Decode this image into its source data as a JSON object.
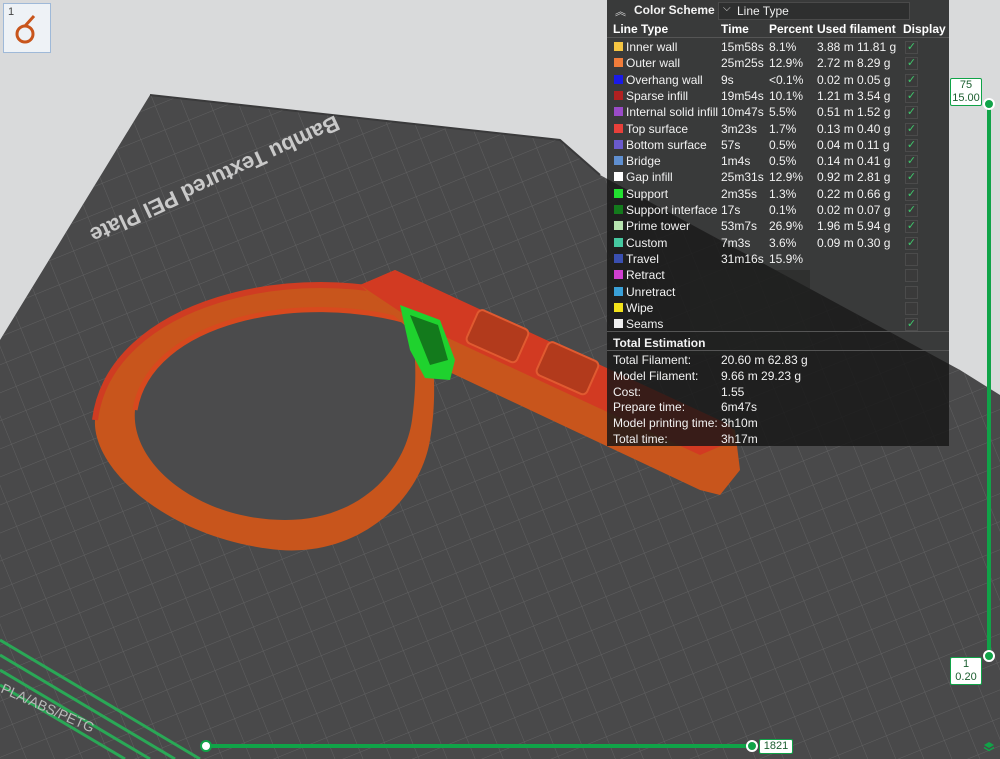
{
  "plate": {
    "text": "Bambu Textured PEI Plate",
    "side_text": "PLA/ABS/PETG"
  },
  "thumbnail": {
    "index": "1"
  },
  "legend": {
    "title": "Color Scheme",
    "scheme_value": "Line Type",
    "headers": {
      "line_type": "Line Type",
      "time": "Time",
      "percent": "Percent",
      "used_filament": "Used filament",
      "display": "Display"
    },
    "rows": [
      {
        "name": "Inner wall",
        "time": "15m58s",
        "percent": "8.1%",
        "filament": "3.88 m  11.81 g",
        "color": "#f5c542",
        "display": true
      },
      {
        "name": "Outer wall",
        "time": "25m25s",
        "percent": "12.9%",
        "filament": "2.72 m  8.29 g",
        "color": "#f07c3a",
        "display": true
      },
      {
        "name": "Overhang wall",
        "time": "9s",
        "percent": "<0.1%",
        "filament": "0.02 m  0.05 g",
        "color": "#1a1ae8",
        "display": true
      },
      {
        "name": "Sparse infill",
        "time": "19m54s",
        "percent": "10.1%",
        "filament": "1.21 m  3.54 g",
        "color": "#b02020",
        "display": true
      },
      {
        "name": "Internal solid infill",
        "time": "10m47s",
        "percent": "5.5%",
        "filament": "0.51 m  1.52 g",
        "color": "#9a4bc8",
        "display": true
      },
      {
        "name": "Top surface",
        "time": "3m23s",
        "percent": "1.7%",
        "filament": "0.13 m  0.40 g",
        "color": "#e8403a",
        "display": true
      },
      {
        "name": "Bottom surface",
        "time": "57s",
        "percent": "0.5%",
        "filament": "0.04 m  0.11 g",
        "color": "#6a5acd",
        "display": true
      },
      {
        "name": "Bridge",
        "time": "1m4s",
        "percent": "0.5%",
        "filament": "0.14 m  0.41 g",
        "color": "#5f8fd0",
        "display": true
      },
      {
        "name": "Gap infill",
        "time": "25m31s",
        "percent": "12.9%",
        "filament": "0.92 m  2.81 g",
        "color": "#ffffff",
        "display": true
      },
      {
        "name": "Support",
        "time": "2m35s",
        "percent": "1.3%",
        "filament": "0.22 m  0.66 g",
        "color": "#22e030",
        "display": true
      },
      {
        "name": "Support interface",
        "time": "17s",
        "percent": "0.1%",
        "filament": "0.02 m  0.07 g",
        "color": "#137a1c",
        "display": true
      },
      {
        "name": "Prime tower",
        "time": "53m7s",
        "percent": "26.9%",
        "filament": "1.96 m  5.94 g",
        "color": "#b7e4b0",
        "display": true
      },
      {
        "name": "Custom",
        "time": "7m3s",
        "percent": "3.6%",
        "filament": "0.09 m  0.30 g",
        "color": "#45c8a0",
        "display": true
      },
      {
        "name": "Travel",
        "time": "31m16s",
        "percent": "15.9%",
        "filament": "",
        "color": "#3a4fb0",
        "display": false
      },
      {
        "name": "Retract",
        "time": "",
        "percent": "",
        "filament": "",
        "color": "#d03fd0",
        "display": false
      },
      {
        "name": "Unretract",
        "time": "",
        "percent": "",
        "filament": "",
        "color": "#3aa0d8",
        "display": false
      },
      {
        "name": "Wipe",
        "time": "",
        "percent": "",
        "filament": "",
        "color": "#f2e21a",
        "display": false
      },
      {
        "name": "Seams",
        "time": "",
        "percent": "",
        "filament": "",
        "color": "#eeeeee",
        "display": true
      }
    ],
    "total_title": "Total Estimation",
    "totals": [
      {
        "label": "Total Filament:",
        "value": "20.60 m    62.83 g"
      },
      {
        "label": "Model Filament:",
        "value": "9.66 m    29.23 g"
      },
      {
        "label": "Cost:",
        "value": "1.55"
      },
      {
        "label": "Prepare time:",
        "value": "6m47s"
      },
      {
        "label": "Model printing time:",
        "value": "3h10m"
      },
      {
        "label": "Total time:",
        "value": "3h17m"
      }
    ]
  },
  "layer_slider": {
    "top_layer": "75",
    "top_height": "15.00",
    "bottom_layer": "1",
    "bottom_height": "0.20",
    "color": "#10a348"
  },
  "move_slider": {
    "value": "1821"
  },
  "colors": {
    "accent": "#10a348",
    "plate": "#4a4a4b",
    "model": "#c8551c"
  }
}
